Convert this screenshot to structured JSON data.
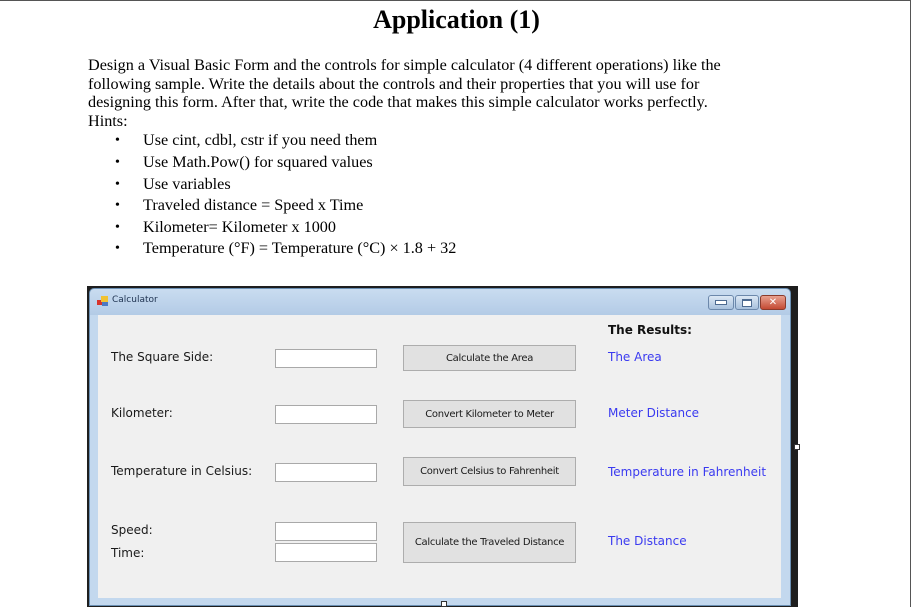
{
  "document": {
    "title": "Application (1)",
    "intro_lines": [
      "Design a Visual Basic Form and the controls for simple calculator (4 different operations) like the",
      "following sample. Write the details about the controls and their properties that you will use for",
      "designing this form. After that, write the code that makes this simple calculator works perfectly.",
      "Hints:"
    ],
    "hints": [
      "Use cint, cdbl, cstr if you need them",
      "Use Math.Pow() for squared values",
      "Use variables",
      "Traveled distance = Speed x Time",
      "Kilometer= Kilometer x 1000",
      "Temperature (°F) = Temperature (°C) × 1.8 + 32"
    ],
    "bullet_glyph": "•"
  },
  "calculator_window": {
    "title": "Calculator",
    "icon": "form-app-icon",
    "controls": {
      "minimize_icon": "minimize-icon",
      "maximize_icon": "maximize-icon",
      "close_glyph": "✕"
    },
    "results_header": "The Results:",
    "rows": [
      {
        "labels": [
          "The Square Side:"
        ],
        "inputs": [
          ""
        ],
        "button": "Calculate the Area",
        "result": "The Area"
      },
      {
        "labels": [
          "Kilometer:"
        ],
        "inputs": [
          ""
        ],
        "button": "Convert Kilometer to Meter",
        "result": "Meter Distance"
      },
      {
        "labels": [
          "Temperature in Celsius:"
        ],
        "inputs": [
          ""
        ],
        "button": "Convert Celsius to Fahrenheit",
        "result": "Temperature in Fahrenheit"
      },
      {
        "labels": [
          "Speed:",
          "Time:"
        ],
        "inputs": [
          "",
          ""
        ],
        "button": "Calculate the Traveled Distance",
        "result": "The Distance"
      }
    ],
    "colors": {
      "result_text": "#3a3af0",
      "client_bg": "#f0f0f0",
      "frame": "#c3d8ee"
    }
  }
}
